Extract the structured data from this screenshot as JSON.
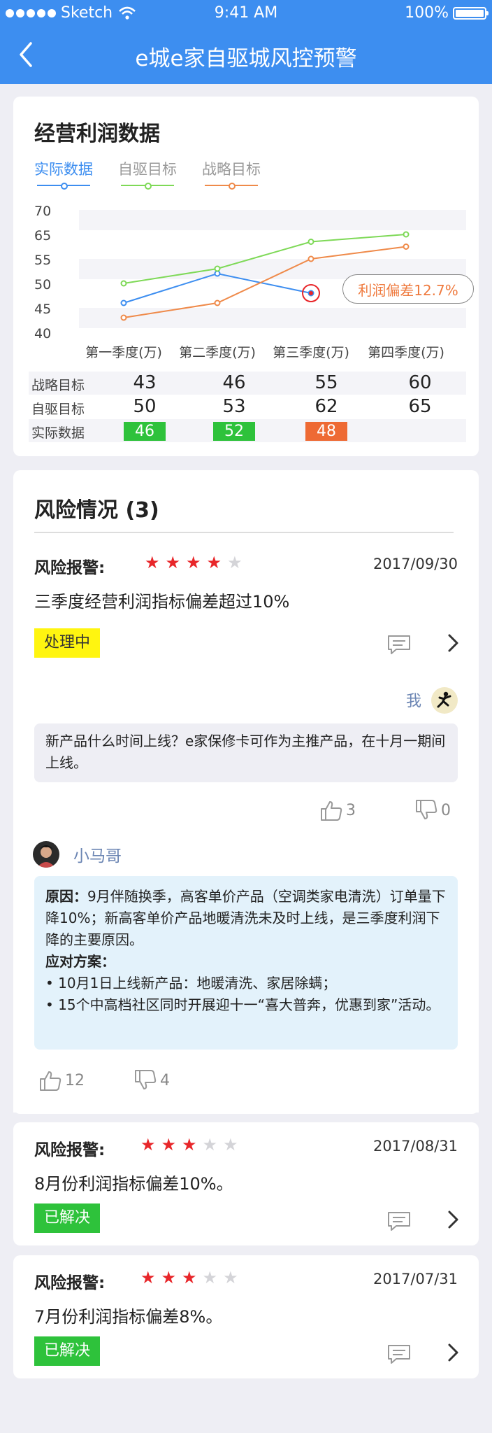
{
  "status_bar": {
    "carrier": "Sketch",
    "time": "9:41 AM",
    "battery": "100%"
  },
  "nav": {
    "title": "e城e家自驱城风控预警",
    "back_icon": "chevron-left-icon"
  },
  "profit": {
    "title": "经营利润数据",
    "legend": [
      "实际数据",
      "自驱目标",
      "战略目标"
    ],
    "deviation_label": "利润偏差12.7%",
    "table": {
      "rows": [
        {
          "label": "战略目标",
          "values": [
            "43",
            "46",
            "55",
            "60"
          ]
        },
        {
          "label": "自驱目标",
          "values": [
            "50",
            "53",
            "62",
            "65"
          ]
        },
        {
          "label": "实际数据",
          "values": [
            "46",
            "52",
            "48",
            ""
          ]
        }
      ]
    }
  },
  "chart_data": {
    "type": "line",
    "categories": [
      "第一季度(万)",
      "第二季度(万)",
      "第三季度(万)",
      "第四季度(万)"
    ],
    "y_ticks": [
      "70",
      "65",
      "55",
      "50",
      "45",
      "40"
    ],
    "series": [
      {
        "name": "实际数据",
        "color": "#3d8ef0",
        "values": [
          46,
          52,
          48,
          null
        ]
      },
      {
        "name": "自驱目标",
        "color": "#7ed957",
        "values": [
          50,
          53,
          62,
          65
        ]
      },
      {
        "name": "战略目标",
        "color": "#ef8a4a",
        "values": [
          43,
          46,
          55,
          60
        ]
      }
    ],
    "grid": true,
    "legend": "top-left"
  },
  "risk": {
    "title": "风险情况 (3)",
    "alerts": [
      {
        "label": "风险报警:",
        "stars": 4,
        "date": "2017/09/30",
        "desc": "三季度经营利润指标偏差超过10%",
        "status": "处理中"
      },
      {
        "label": "风险报警:",
        "stars": 3,
        "date": "2017/08/31",
        "desc": "8月份利润指标偏差10%。",
        "status": "已解决"
      },
      {
        "label": "风险报警:",
        "stars": 3,
        "date": "2017/07/31",
        "desc": "7月份利润指标偏差8%。",
        "status": "已解决"
      }
    ],
    "thread": {
      "me_name": "我",
      "me_text": "新产品什么时间上线？e家保修卡可作为主推产品，在十月一期间上线。",
      "me_likes": "3",
      "me_dislikes": "0",
      "reply_name": "小马哥",
      "reply_reason_label": "原因：",
      "reply_reason": "9月伴随换季，高客单价产品（空调类家电清洗）订单量下降10%；新高客单价产品地暖清洗未及时上线，是三季度利润下降的主要原因。",
      "reply_plan_label": "应对方案：",
      "reply_plan_1": "• 10月1日上线新产品：地暖清洗、家居除螨；",
      "reply_plan_2": "• 15个中高档社区同时开展迎十一“喜大普奔，优惠到家”活动。",
      "reply_likes": "12",
      "reply_dislikes": "4"
    }
  }
}
